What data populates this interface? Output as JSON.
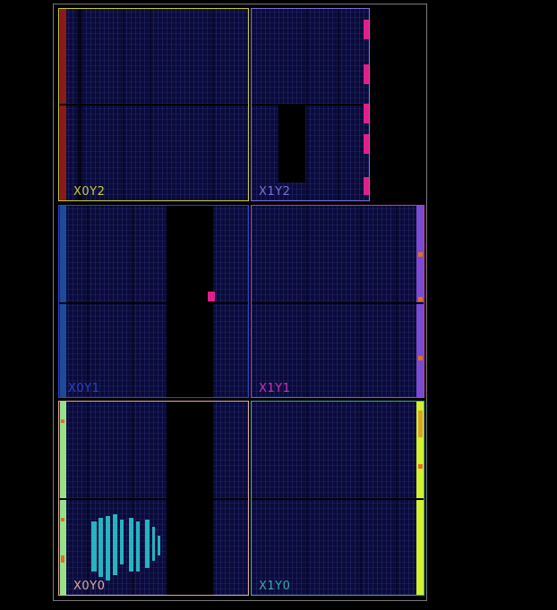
{
  "regions": {
    "x0y2": {
      "label": "X0Y2",
      "color": "#c8c83a"
    },
    "x1y2": {
      "label": "X1Y2",
      "color": "#7a6fd8"
    },
    "x0y1": {
      "label": "X0Y1",
      "color": "#2a46c8"
    },
    "x1y1": {
      "label": "X1Y1",
      "color": "#d030b8"
    },
    "x0y0": {
      "label": "X0Y0",
      "color": "#e0a8a0"
    },
    "x1y0": {
      "label": "X1Y0",
      "color": "#3aa8a8"
    }
  },
  "colors": {
    "fabric": "#0a0b3a",
    "io_bank_red": "#8b1a1a",
    "io_bank_blue": "#1e4a9a",
    "io_bank_green": "#9ae08a",
    "io_bank_purple": "#7a4ad0",
    "io_bank_yellow": "#d0f030",
    "placed_magenta": "#e0208a",
    "placed_cyan": "#27b3c0",
    "placed_orange": "#e07020"
  }
}
